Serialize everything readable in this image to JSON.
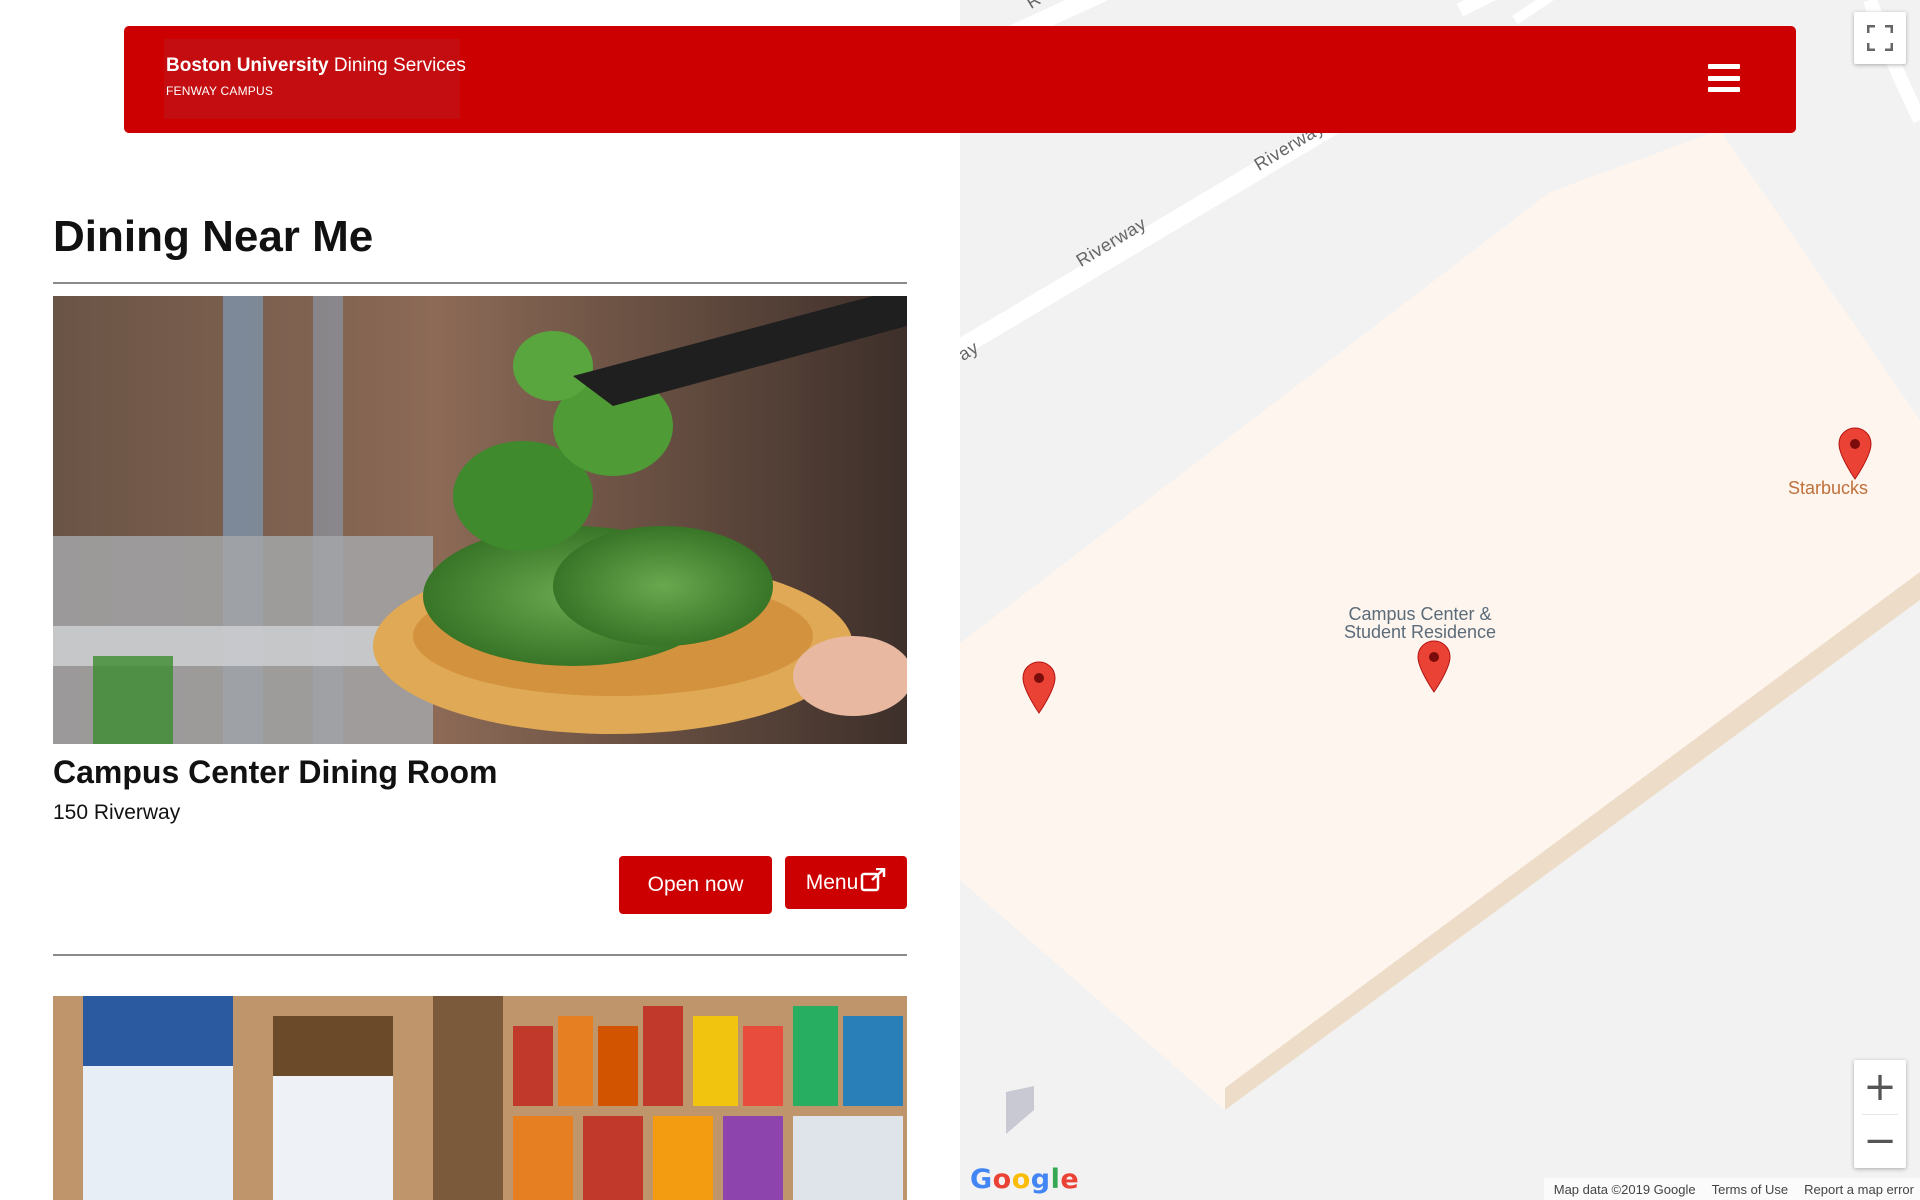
{
  "header": {
    "brand_bold": "Boston University",
    "brand_regular": " Dining Services",
    "campus": "FENWAY CAMPUS",
    "menu_icon": "hamburger-menu-icon",
    "background_color": "#cc0000"
  },
  "main": {
    "title": "Dining Near Me",
    "locations": [
      {
        "photo": "salad-bar-photo",
        "name": "Campus Center Dining Room",
        "address": "150 Riverway",
        "status_label": "Open now",
        "menu_label": "Menu",
        "menu_icon": "external-link-icon"
      },
      {
        "photo": "snack-shelf-photo"
      }
    ]
  },
  "map": {
    "road_labels": [
      "Riverway",
      "Riverway",
      "ay",
      "R"
    ],
    "place_label_line1": "Campus Center &",
    "place_label_line2": "Student Residence",
    "poi_label": "Starbucks",
    "pin_color": "#ea4335",
    "fullscreen_icon": "fullscreen-icon",
    "zoom_in": "+",
    "zoom_out": "−",
    "google_logo": "Google",
    "footer": {
      "map_data": "Map data ©2019 Google",
      "terms": "Terms of Use",
      "report": "Report a map error"
    }
  }
}
